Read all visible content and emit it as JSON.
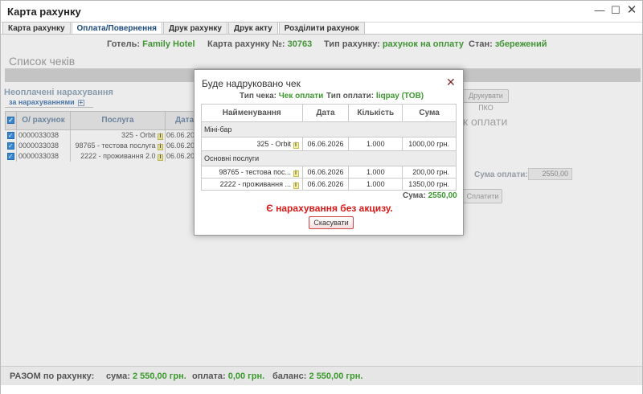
{
  "window": {
    "title": "Карта рахунку",
    "colors": {
      "accent": "#3c9a2e",
      "link": "#1d4a7e",
      "warn": "#d91818"
    }
  },
  "tabs": [
    "Карта рахунку",
    "Оплата/Повернення",
    "Друк рахунку",
    "Друк акту",
    "Розділити рахунок"
  ],
  "active_tab": "Оплата/Повернення",
  "header": {
    "hotel_label": "Готель:",
    "hotel_value": "Family Hotel",
    "card_label": "Карта рахунку №:",
    "card_value": "30763",
    "type_label": "Тип рахунку:",
    "type_value": "рахунок на оплату",
    "state_label": "Стан:",
    "state_value": "збережений"
  },
  "left": {
    "checks_title": "Список чеків",
    "unpaid_title": "Неоплачені нарахування",
    "by_charges": "за нарахуваннями",
    "columns": [
      "О/ рахунок",
      "Послуга",
      "Дата"
    ],
    "rows": [
      {
        "account": "0000033038",
        "service": "325 - Orbit",
        "date": "06.06.20"
      },
      {
        "account": "0000033038",
        "service": "98765 - тестова послуга",
        "date": "06.06.20"
      },
      {
        "account": "0000033038",
        "service": "2222 - проживання 2.0",
        "date": "06.06.20"
      }
    ]
  },
  "right": {
    "print_pko": "Друкувати ПКО",
    "payment_title": "к оплати",
    "sum_label": "Сума оплати:",
    "sum_value": "2550,00",
    "pay_button": "Сплатити"
  },
  "footer": {
    "total_label": "РАЗОМ по рахунку:",
    "sum_label": "сума:",
    "sum_value": "2 550,00 грн.",
    "paid_label": "оплата:",
    "paid_value": "0,00 грн.",
    "balance_label": "баланс:",
    "balance_value": "2 550,00 грн."
  },
  "dialog": {
    "title": "Буде надруковано чек",
    "check_type_label": "Тип чека:",
    "check_type_value": "Чек оплати",
    "pay_type_label": "Тип оплати:",
    "pay_type_value": "liqpay (ТОВ)",
    "columns": [
      "Найменування",
      "Дата",
      "Кількість",
      "Сума"
    ],
    "groups": [
      {
        "name": "Міні-бар",
        "items": [
          {
            "name": "325 - Orbit",
            "date": "06.06.2026",
            "qty": "1.000",
            "sum": "1000,00 грн."
          }
        ]
      },
      {
        "name": "Основні послуги",
        "items": [
          {
            "name": "98765 - тестова пос...",
            "date": "06.06.2026",
            "qty": "1.000",
            "sum": "200,00 грн."
          },
          {
            "name": "2222 - проживання ...",
            "date": "06.06.2026",
            "qty": "1.000",
            "sum": "1350,00 грн."
          }
        ]
      }
    ],
    "sum_label": "Сума:",
    "sum_value": "2550,00",
    "warning": "Є нарахування без акцизу.",
    "cancel": "Скасувати"
  }
}
